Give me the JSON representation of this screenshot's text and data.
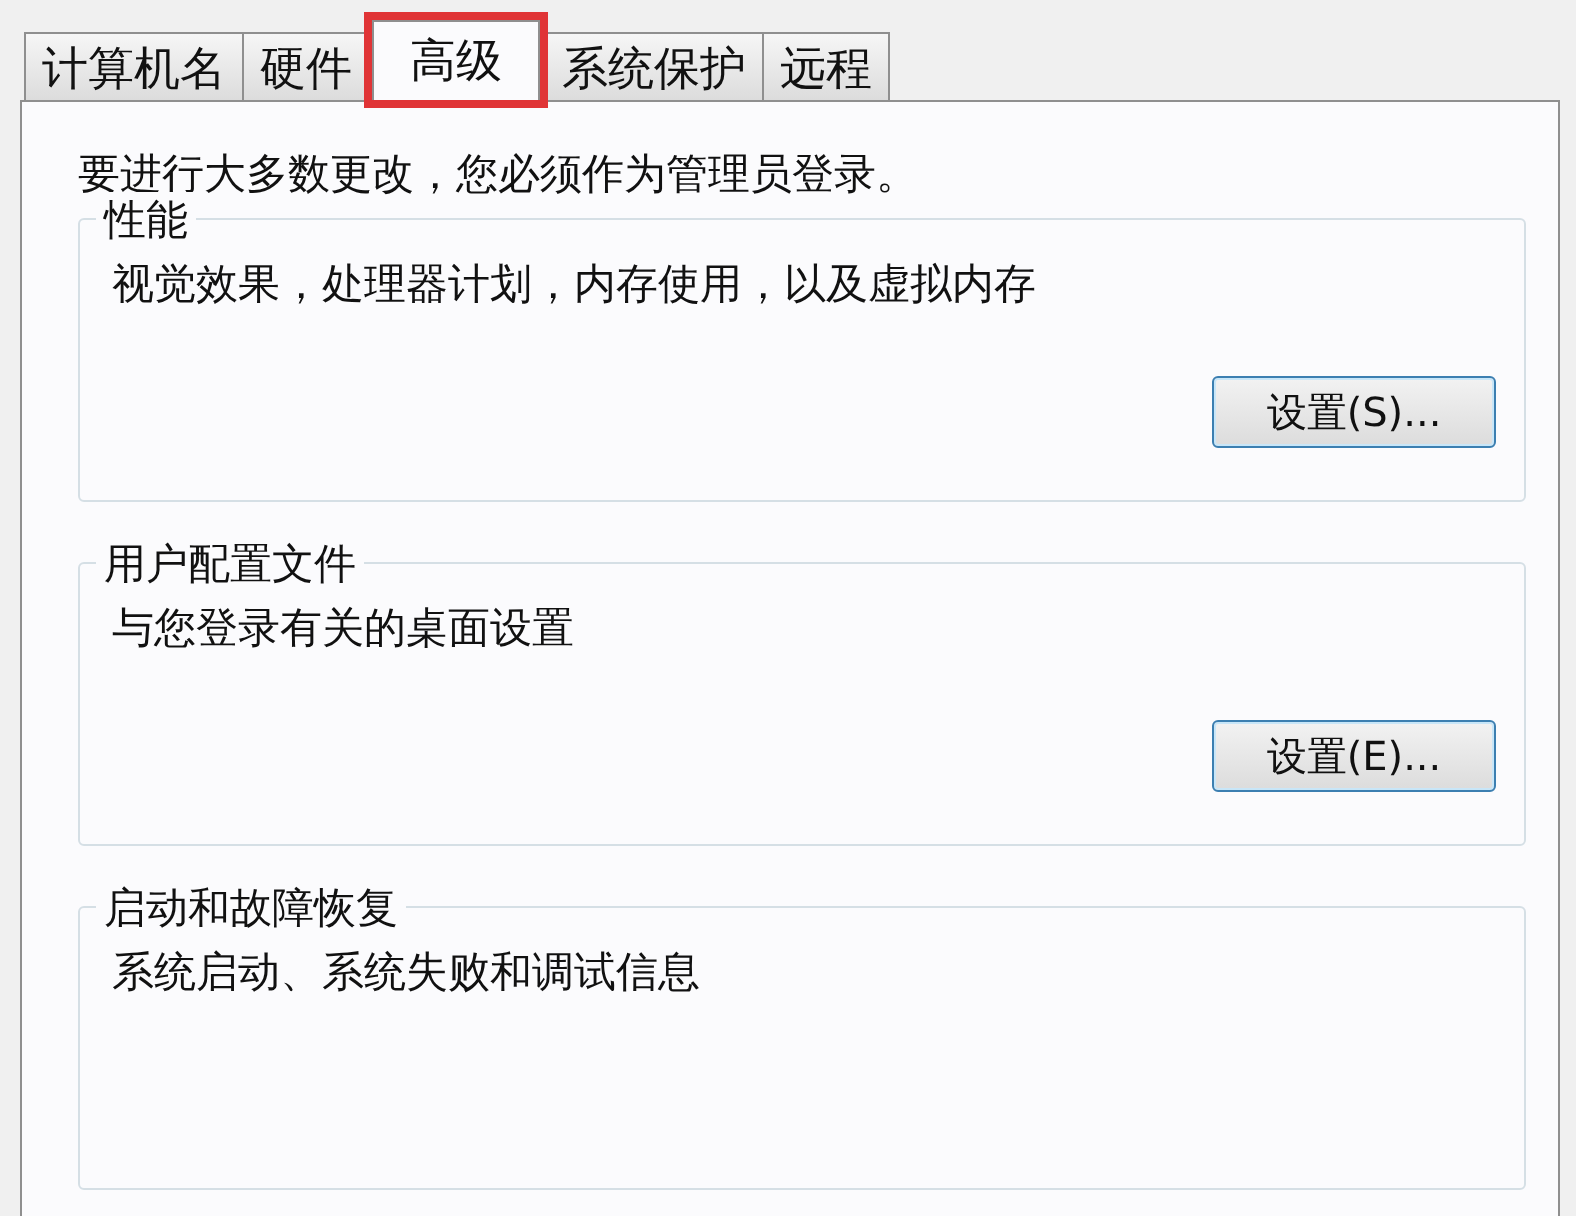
{
  "tabs": [
    {
      "label": "计算机名",
      "selected": false,
      "highlighted": false
    },
    {
      "label": "硬件",
      "selected": false,
      "highlighted": false
    },
    {
      "label": "高级",
      "selected": true,
      "highlighted": true
    },
    {
      "label": "系统保护",
      "selected": false,
      "highlighted": false
    },
    {
      "label": "远程",
      "selected": false,
      "highlighted": false
    }
  ],
  "notice": "要进行大多数更改，您必须作为管理员登录。",
  "groups": [
    {
      "title": "性能",
      "description": "视觉效果，处理器计划，内存使用，以及虚拟内存",
      "button": "设置(S)..."
    },
    {
      "title": "用户配置文件",
      "description": "与您登录有关的桌面设置",
      "button": "设置(E)..."
    },
    {
      "title": "启动和故障恢复",
      "description": "系统启动、系统失败和调试信息"
    }
  ]
}
